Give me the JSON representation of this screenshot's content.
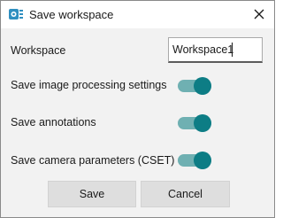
{
  "window": {
    "title": "Save workspace",
    "icon": "app-gear-icon",
    "close_icon": "close-icon"
  },
  "form": {
    "workspace_label": "Workspace",
    "workspace_value": "Workspace1",
    "settings": [
      {
        "label": "Save image processing settings",
        "enabled": true
      },
      {
        "label": "Save annotations",
        "enabled": true
      },
      {
        "label": "Save camera parameters (CSET)",
        "enabled": true
      }
    ]
  },
  "buttons": {
    "save_label": "Save",
    "cancel_label": "Cancel"
  },
  "colors": {
    "accent": "#0d7d85",
    "toggle_track": "#6fb0b2",
    "content_bg": "#f2f2f2"
  }
}
